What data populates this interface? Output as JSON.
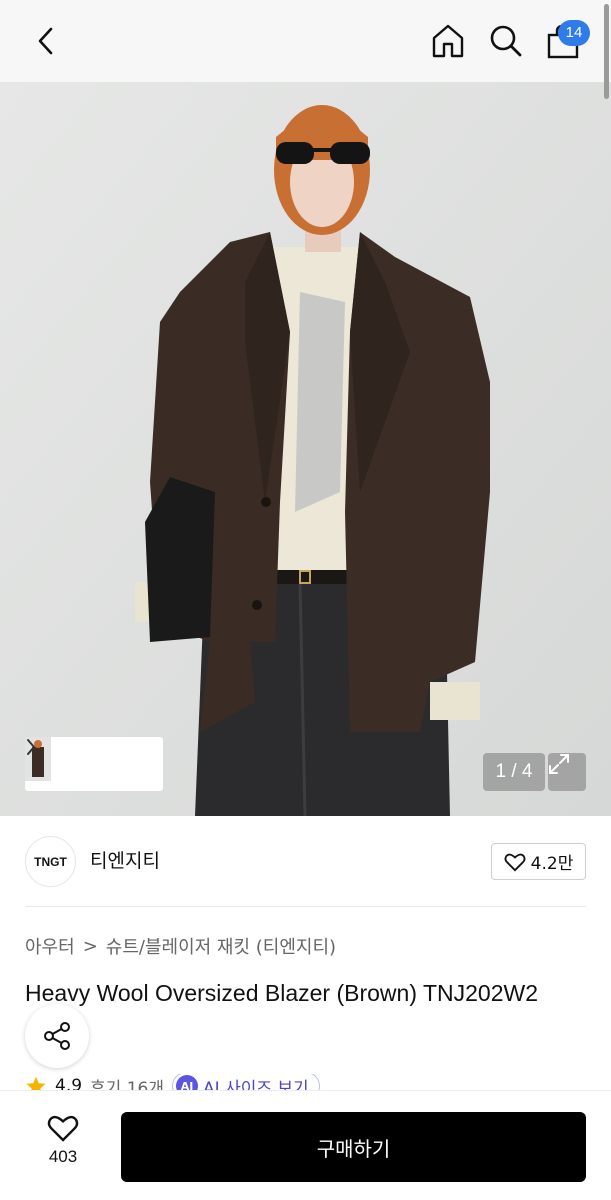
{
  "nav": {
    "back_icon": "chevron-left-icon",
    "home_icon": "home-icon",
    "search_icon": "search-icon",
    "cart_icon": "shopping-bag-icon",
    "cart_count": "14",
    "badge_color": "#2f7bea"
  },
  "gallery": {
    "pager": "1 / 4",
    "expand_icon": "expand-icon",
    "thumb_arrow_icon": "chevron-right-icon"
  },
  "brand": {
    "logo_text": "TNGT",
    "name": "티엔지티",
    "like_count": "4.2만"
  },
  "breadcrumb": {
    "category": "아우터",
    "separator": ">",
    "subcategory": "슈트/블레이저 재킷 (티엔지티)"
  },
  "product": {
    "title": "Heavy Wool Oversized Blazer (Brown) TNJ202W2",
    "rating": "4.9",
    "review_label": "후기 16개",
    "size_chip": "AI 사이즈 보기",
    "ai_badge": "AI"
  },
  "bottom": {
    "wish_count": "403",
    "buy_label": "구매하기"
  },
  "colors": {
    "buy_button": "#000000",
    "star": "#f4b400",
    "ai_chip": "#5b55e0"
  }
}
